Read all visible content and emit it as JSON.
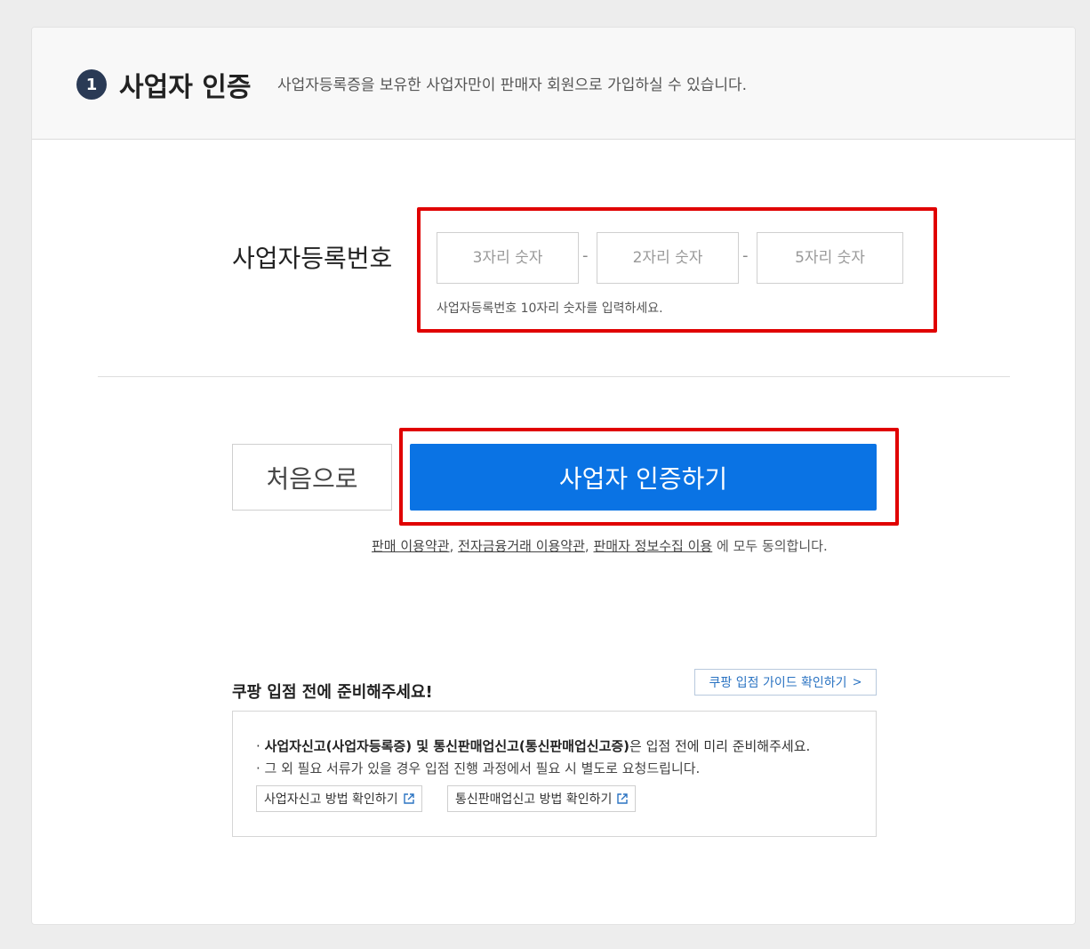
{
  "header": {
    "step_number": "1",
    "title": "사업자 인증",
    "description": "사업자등록증을 보유한 사업자만이 판매자 회원으로 가입하실 수 있습니다."
  },
  "biz_number": {
    "label": "사업자등록번호",
    "part1_placeholder": "3자리 숫자",
    "part2_placeholder": "2자리 숫자",
    "part3_placeholder": "5자리 숫자",
    "separator": "-",
    "hint": "사업자등록번호 10자리 숫자를 입력하세요."
  },
  "actions": {
    "back_label": "처음으로",
    "verify_label": "사업자 인증하기"
  },
  "terms": {
    "link1": "판매 이용약관",
    "link2": "전자금융거래 이용약관",
    "link3": "판매자 정보수집 이용",
    "separator": ",",
    "suffix": " 에 모두 동의합니다."
  },
  "prep": {
    "title": "쿠팡 입점 전에 준비해주세요!",
    "guide_link": "쿠팡 입점 가이드 확인하기",
    "guide_chevron": ">",
    "bullet": "·",
    "line1_bold": "사업자신고(사업자등록증) 및 통신판매업신고(통신판매업신고증)",
    "line1_rest": "은 입점 전에 미리 준비해주세요.",
    "line2": "· 그 외 필요 서류가 있을 경우 입점 진행 과정에서 필요 시 별도로 요청드립니다.",
    "btn1": "사업자신고 방법 확인하기",
    "btn2": "통신판매업신고 방법 확인하기"
  },
  "colors": {
    "primary": "#0a73e4",
    "highlight": "#e00000",
    "badge": "#2a3a55",
    "link": "#2a73c2"
  }
}
